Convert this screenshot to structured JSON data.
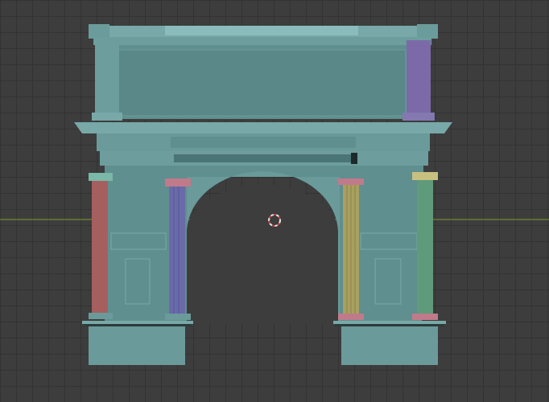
{
  "viewport": {
    "grid_color": "#333333",
    "background_color": "#3d3d3d",
    "axis_color": "#7b9a2a"
  },
  "model": {
    "body_color": "#5f8f8f",
    "highlight_color": "#78a8a8",
    "shadow_color": "#4b7474",
    "column_colors": [
      "#a65f5f",
      "#6a6aa8",
      "#a8a060",
      "#5f9a7a"
    ],
    "capital_colors": [
      "#7ab8a8",
      "#c07a8a",
      "#c07a8a",
      "#c8c080"
    ],
    "accent_panel_color": "#7c6aa8"
  },
  "cursor": {
    "icon": "3d-cursor-icon",
    "ring_color_a": "#e8e8e8",
    "ring_color_b": "#d04040"
  }
}
